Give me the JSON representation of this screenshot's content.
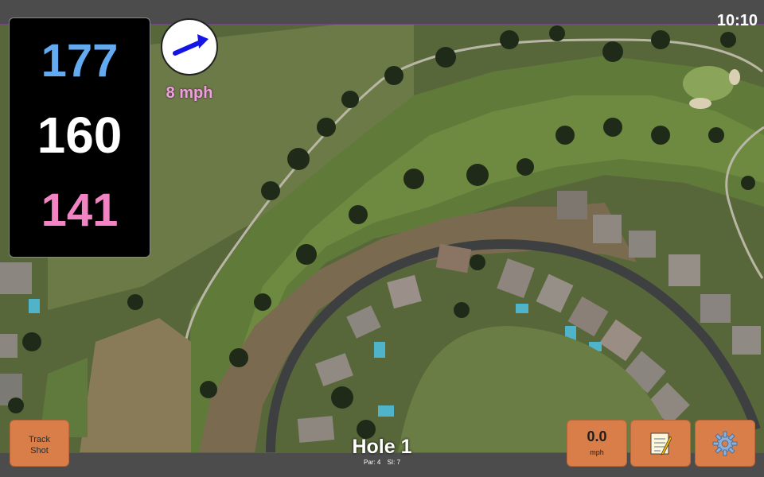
{
  "status_bar": {
    "time": "10:10"
  },
  "yardages": {
    "back": "177",
    "middle": "160",
    "front": "141"
  },
  "wind": {
    "speed": "8 mph",
    "icon": "wind-direction-arrow-icon"
  },
  "hole": {
    "title": "Hole 1",
    "par": "Par: 4",
    "stroke_index": "SI: 7"
  },
  "buttons": {
    "track_shot": {
      "line1": "Track",
      "line2": "Shot"
    },
    "speed": {
      "value": "0.0",
      "unit": "mph"
    },
    "notes": {
      "icon": "notepad-icon"
    },
    "settings": {
      "icon": "gear-icon"
    }
  },
  "colors": {
    "back_yardage": "#64aaf0",
    "middle_yardage": "#ffffff",
    "front_yardage": "#f284c4",
    "wind_speed": "#f0a0e0",
    "button": "#d97e48",
    "wind_arrow": "#1414e6"
  }
}
